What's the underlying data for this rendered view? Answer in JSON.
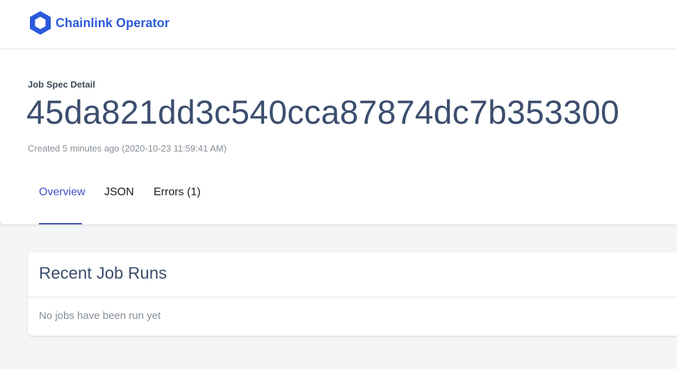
{
  "app": {
    "logo_icon": "chainlink-hexagon-icon",
    "brand_color": "#2a5ada",
    "title": "Chainlink Operator"
  },
  "job": {
    "breadcrumb": "Job Spec Detail",
    "id": "45da821dd3c540cca87874dc7b353300",
    "created": "Created 5 minutes ago (2020-10-23 11:59:41 AM)"
  },
  "tabs": [
    {
      "label": "Overview",
      "active": true
    },
    {
      "label": "JSON",
      "active": false
    },
    {
      "label": "Errors (1)",
      "active": false
    }
  ],
  "recent_runs": {
    "title": "Recent Job Runs",
    "empty_message": "No jobs have been run yet"
  },
  "colors": {
    "accent": "#3f51b5",
    "heading": "#3c4e6e",
    "muted": "#868e96",
    "background": "#f4f5f7"
  }
}
